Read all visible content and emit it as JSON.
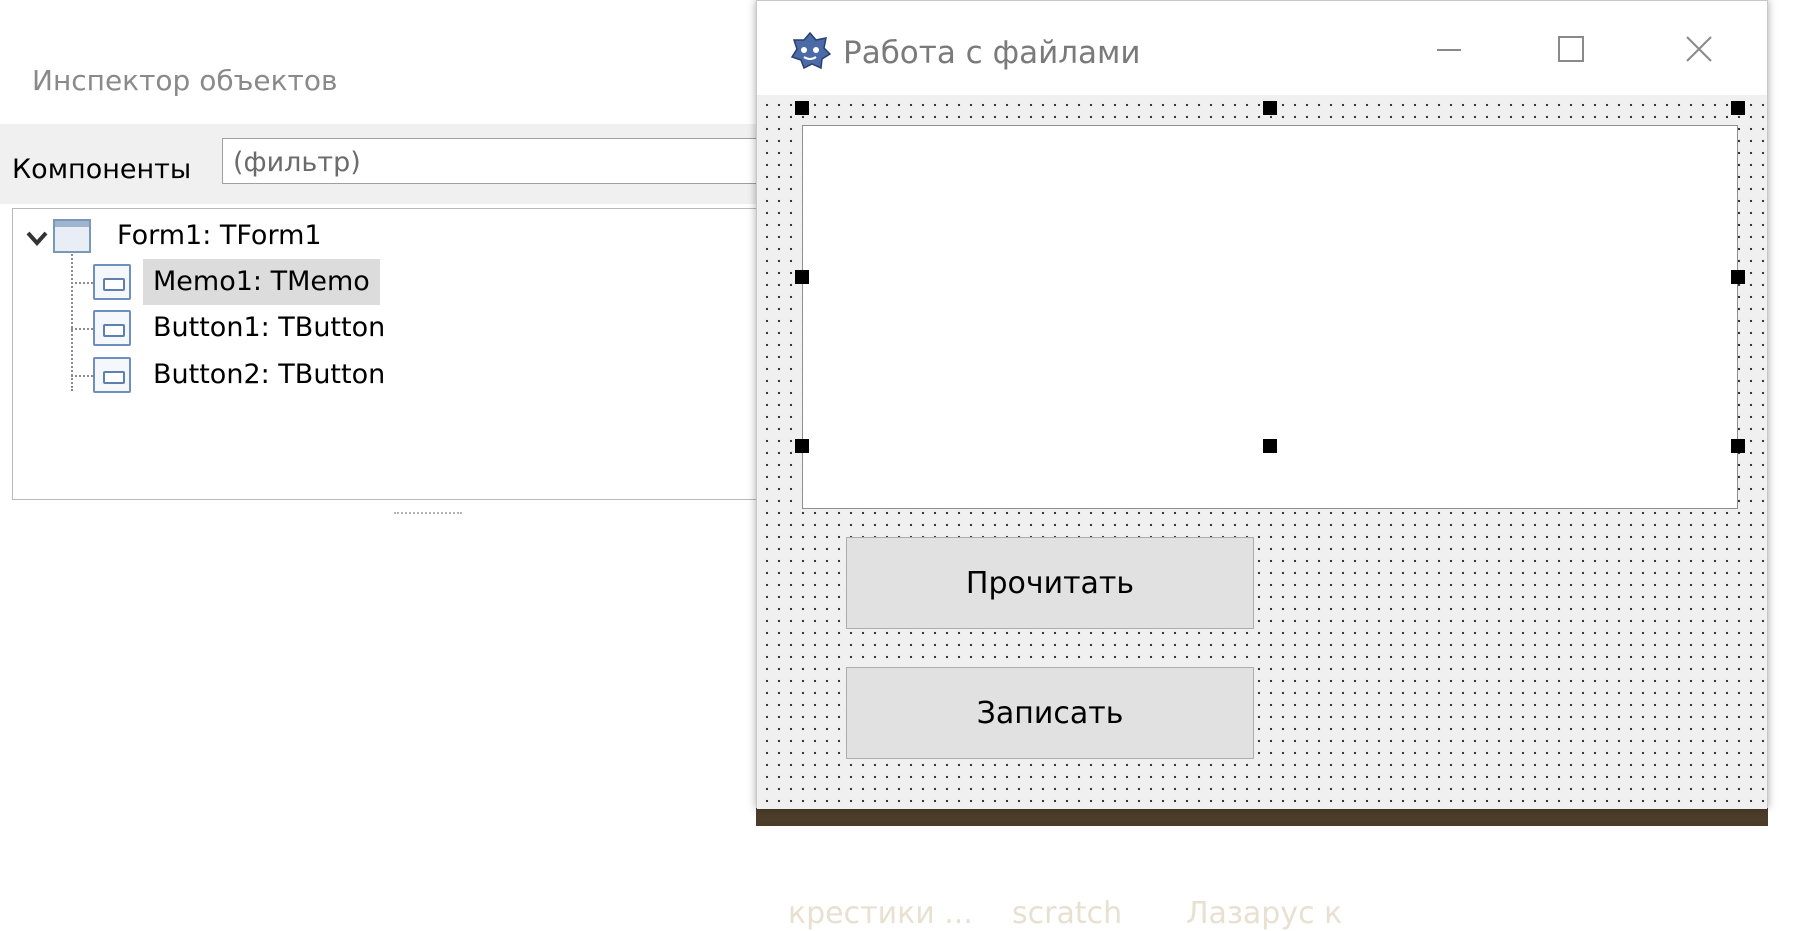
{
  "inspector": {
    "title": "Инспектор объектов",
    "components_label": "Компоненты",
    "filter_placeholder": "(фильтр)",
    "tree": [
      {
        "label": "Form1: TForm1",
        "icon": "form-icon",
        "expanded": true
      },
      {
        "label": "Memo1: TMemo",
        "icon": "memo-icon",
        "selected": true
      },
      {
        "label": "Button1: TButton",
        "icon": "button-icon"
      },
      {
        "label": "Button2: TButton",
        "icon": "button-icon"
      }
    ]
  },
  "form_window": {
    "title": "Работа с файлами",
    "buttons": {
      "read_label": "Прочитать",
      "write_label": "Записать"
    },
    "window_controls": [
      "minimize-icon",
      "maximize-icon",
      "close-icon"
    ]
  },
  "background": {
    "taskbar_texts": [
      "крестики ...",
      "scratch",
      "Лазарус к"
    ]
  },
  "colors": {
    "selection": "#dcdcdc",
    "button_face": "#e1e1e1",
    "form_face": "#f0f0f0",
    "design_handle": "#000000"
  }
}
